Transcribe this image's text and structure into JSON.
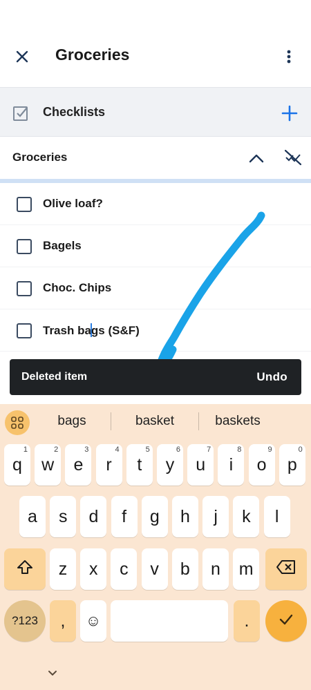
{
  "app_bar": {
    "title": "Groceries",
    "close_icon": "close-icon",
    "menu_icon": "more-vert-icon"
  },
  "checklists": {
    "label": "Checklists",
    "icon": "checkbox-icon",
    "add_icon": "plus-icon",
    "accent": "#1a73e8"
  },
  "group": {
    "title": "Groceries",
    "collapse_icon": "chevron-up-icon",
    "hide_checked_icon": "hide-checked-icon"
  },
  "items": [
    {
      "label": "Olive loaf?",
      "checked": false
    },
    {
      "label": "Bagels",
      "checked": false
    },
    {
      "label": "Choc. Chips",
      "checked": false
    },
    {
      "label_before_cursor": "Trash ba",
      "label_after_cursor": "gs (S&F)",
      "checked": false
    }
  ],
  "snackbar": {
    "message": "Deleted item",
    "action": "Undo"
  },
  "keyboard": {
    "suggestions": [
      "bags",
      "basket",
      "baskets"
    ],
    "row1": [
      {
        "k": "q",
        "h": "1"
      },
      {
        "k": "w",
        "h": "2"
      },
      {
        "k": "e",
        "h": "3"
      },
      {
        "k": "r",
        "h": "4"
      },
      {
        "k": "t",
        "h": "5"
      },
      {
        "k": "y",
        "h": "6"
      },
      {
        "k": "u",
        "h": "7"
      },
      {
        "k": "i",
        "h": "8"
      },
      {
        "k": "o",
        "h": "9"
      },
      {
        "k": "p",
        "h": "0"
      }
    ],
    "row2": [
      "a",
      "s",
      "d",
      "f",
      "g",
      "h",
      "j",
      "k",
      "l"
    ],
    "row3": [
      "z",
      "x",
      "c",
      "v",
      "b",
      "n",
      "m"
    ],
    "symbols_label": "?123",
    "comma": ",",
    "period": ".",
    "emoji": "☺",
    "shift_icon": "shift-icon",
    "backspace_icon": "backspace-icon",
    "enter_icon": "check-icon",
    "apps_icon": "grid-icon",
    "hide_icon": "chevron-down-icon",
    "colors": {
      "background": "#fbe6d2",
      "function_key": "#fbd49a",
      "accent": "#f7b13e"
    }
  }
}
